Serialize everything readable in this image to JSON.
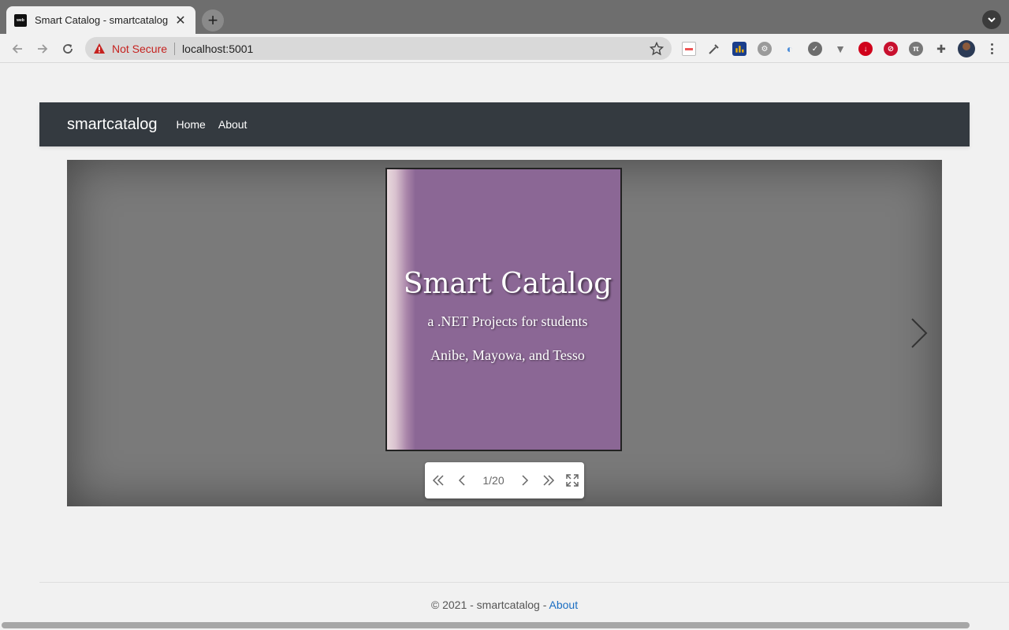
{
  "browser": {
    "tab_title": "Smart Catalog - smartcatalog",
    "favicon_text": "web",
    "security_label": "Not Secure",
    "url": "localhost:5001"
  },
  "navbar": {
    "brand": "smartcatalog",
    "links": [
      "Home",
      "About"
    ]
  },
  "viewer": {
    "cover": {
      "title": "Smart Catalog",
      "subtitle": "a .NET Projects for students",
      "authors": "Anibe, Mayowa, and Tesso",
      "color": "#8b6795"
    },
    "page_indicator": "1/20",
    "current_page": 1,
    "total_pages": 20
  },
  "footer": {
    "text": "© 2021 - smartcatalog - ",
    "link": "About"
  },
  "colors": {
    "navbar_bg": "#343a40",
    "link_blue": "#1b6ec2",
    "warning_red": "#c5221f"
  }
}
